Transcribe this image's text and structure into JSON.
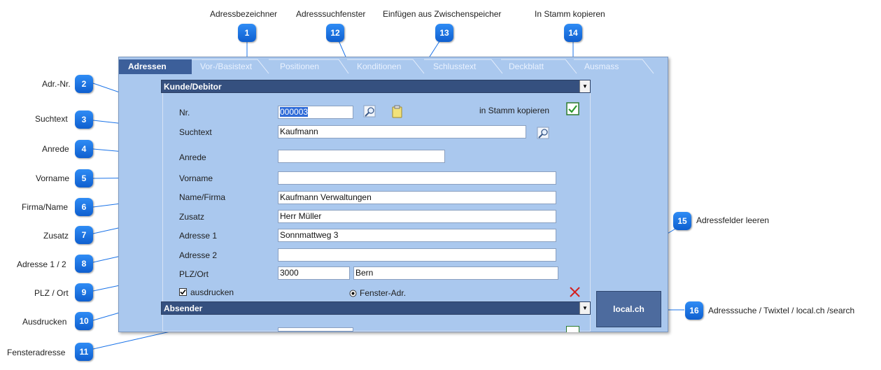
{
  "callouts": {
    "c1": {
      "num": "1",
      "label": "Adressbezeichner"
    },
    "c2": {
      "num": "2",
      "label": "Adr.-Nr."
    },
    "c3": {
      "num": "3",
      "label": "Suchtext"
    },
    "c4": {
      "num": "4",
      "label": "Anrede"
    },
    "c5": {
      "num": "5",
      "label": "Vorname"
    },
    "c6": {
      "num": "6",
      "label": "Firma/Name"
    },
    "c7": {
      "num": "7",
      "label": "Zusatz"
    },
    "c8": {
      "num": "8",
      "label": "Adresse 1 / 2"
    },
    "c9": {
      "num": "9",
      "label": "PLZ / Ort"
    },
    "c10": {
      "num": "10",
      "label": "Ausdrucken"
    },
    "c11": {
      "num": "11",
      "label": "Fensteradresse"
    },
    "c12": {
      "num": "12",
      "label": "Adresssuchfenster"
    },
    "c13": {
      "num": "13",
      "label": "Einfügen aus Zwischenspeicher"
    },
    "c14": {
      "num": "14",
      "label": "In Stamm kopieren"
    },
    "c15": {
      "num": "15",
      "label": "Adressfelder leeren"
    },
    "c16": {
      "num": "16",
      "label": "Adresssuche / Twixtel / local.ch /search"
    }
  },
  "tabs": [
    "Adressen",
    "Vor-/Basistext",
    "Positionen",
    "Konditionen",
    "Schlusstext",
    "Deckblatt",
    "Ausmass"
  ],
  "sections": {
    "kunde": "Kunde/Debitor",
    "absender": "Absender",
    "dropdown_glyph": "▼"
  },
  "form": {
    "nr_label": "Nr.",
    "nr_value": "000003",
    "copy_label": "in Stamm kopieren",
    "suchtext_label": "Suchtext",
    "suchtext_value": "Kaufmann",
    "anrede_label": "Anrede",
    "anrede_value": "",
    "vorname_label": "Vorname",
    "vorname_value": "",
    "name_label": "Name/Firma",
    "name_value": "Kaufmann Verwaltungen",
    "zusatz_label": "Zusatz",
    "zusatz_value": "Herr Müller",
    "adresse1_label": "Adresse 1",
    "adresse1_value": "Sonnmattweg 3",
    "adresse2_label": "Adresse 2",
    "adresse2_value": "",
    "plz_label": "PLZ/Ort",
    "plz_value": "3000",
    "ort_value": "Bern",
    "ausdrucken_label": "ausdrucken",
    "fenster_label": "Fenster-Adr."
  },
  "local_button": "local.ch",
  "colors": {
    "badge": "#1a73e8",
    "window": "#aac8ee",
    "header": "#35507f"
  }
}
